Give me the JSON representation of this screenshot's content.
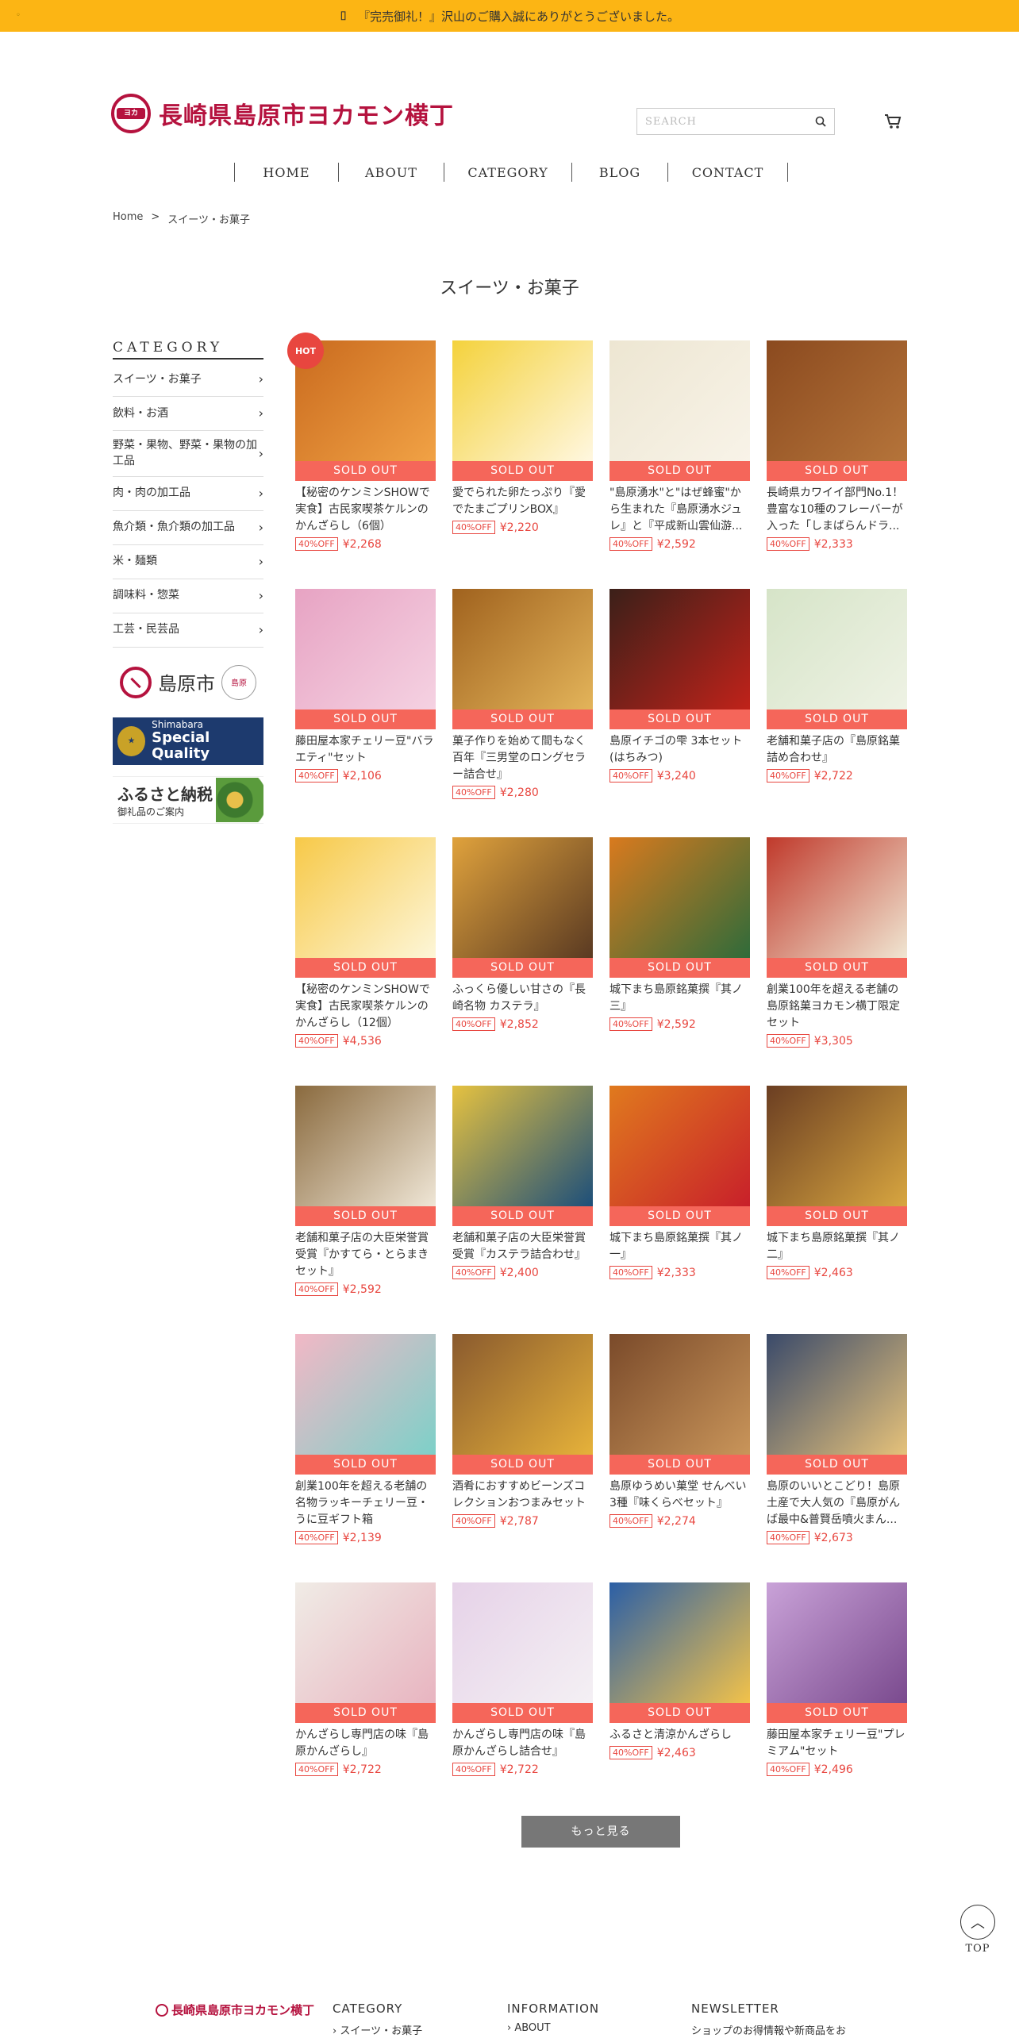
{
  "announcement": {
    "mark": "⌷",
    "text": "『完売御礼！』沢山のご購入誠にありがとうございました。"
  },
  "header": {
    "logo_text": "長崎県島原市ヨカモン横丁",
    "search_placeholder": "SEARCH",
    "nav": [
      "HOME",
      "ABOUT",
      "CATEGORY",
      "BLOG",
      "CONTACT"
    ]
  },
  "breadcrumb": {
    "home": "Home",
    "sep": ">",
    "current": "スイーツ・お菓子"
  },
  "page_title": "スイーツ・お菓子",
  "sidebar": {
    "heading": "CATEGORY",
    "categories": [
      "スイーツ・お菓子",
      "飲料・お酒",
      "野菜・果物、野菜・果物の加工品",
      "肉・肉の加工品",
      "魚介類・魚介類の加工品",
      "米・麺類",
      "調味料・惣菜",
      "工芸・民芸品"
    ],
    "banner_city": "島原市",
    "banner_quality_top": "Shimabara",
    "banner_quality_main": "Special Quality",
    "banner_furusato": "ふるさと納税",
    "banner_furusato_sub": "御礼品のご案内"
  },
  "products": [
    {
      "name": "【秘密のケンミンSHOWで実食】古民家喫茶ケルンのかんざらし（6個）",
      "price": "¥2,268",
      "hot": true,
      "colors": [
        "#c96a1e",
        "#f1a245"
      ]
    },
    {
      "name": "愛でられた卵たっぷり『愛でたまごプリンBOX』",
      "price": "¥2,220",
      "colors": [
        "#f4d23c",
        "#fff7e0"
      ]
    },
    {
      "name": "\"島原湧水\"と\"はぜ蜂蜜\"から生まれた『島原湧水ジュレ』と『平成新山雲仙游...",
      "price": "¥2,592",
      "colors": [
        "#ede6d2",
        "#f8f3e8"
      ]
    },
    {
      "name": "長崎県カワイイ部門No.1！豊富な10種のフレーバーが入った「しまばらんドラ...",
      "price": "¥2,333",
      "colors": [
        "#8b4a1f",
        "#b5743a"
      ]
    },
    {
      "name": "藤田屋本家チェリー豆\"バラエティ\"セット",
      "price": "¥2,106",
      "colors": [
        "#e7a3c3",
        "#f5d2e2"
      ]
    },
    {
      "name": "菓子作りを始めて間もなく百年『三男堂のロングセラー詰合せ』",
      "price": "¥2,280",
      "colors": [
        "#a0621e",
        "#e3b45a"
      ]
    },
    {
      "name": "島原イチゴの雫 3本セット(はちみつ)",
      "price": "¥3,240",
      "colors": [
        "#3b2019",
        "#c0221a"
      ]
    },
    {
      "name": "老舗和菓子店の『島原銘菓詰め合わせ』",
      "price": "¥2,722",
      "colors": [
        "#d6e4c8",
        "#eef2e4"
      ]
    },
    {
      "name": "【秘密のケンミンSHOWで実食】古民家喫茶ケルンのかんざらし（12個）",
      "price": "¥4,536",
      "colors": [
        "#f7c948",
        "#fdf6d8"
      ]
    },
    {
      "name": "ふっくら優しい甘さの『長崎名物 カステラ』",
      "price": "¥2,852",
      "colors": [
        "#e0a23c",
        "#5a3a22"
      ]
    },
    {
      "name": "城下まち島原銘菓撰『其ノ三』",
      "price": "¥2,592",
      "colors": [
        "#d97a1e",
        "#2f6b3a"
      ]
    },
    {
      "name": "創業100年を超える老舗の島原銘菓ヨカモン横丁限定セット",
      "price": "¥3,305",
      "colors": [
        "#c0392b",
        "#f0e6d2"
      ]
    },
    {
      "name": "老舗和菓子店の大臣栄誉賞受賞『かすてら・とらまきセット』",
      "price": "¥2,592",
      "colors": [
        "#8a6a3e",
        "#efe6d6"
      ]
    },
    {
      "name": "老舗和菓子店の大臣栄誉賞受賞『カステラ詰合わせ』",
      "price": "¥2,400",
      "colors": [
        "#e6c240",
        "#1d4f7a"
      ]
    },
    {
      "name": "城下まち島原銘菓撰『其ノ一』",
      "price": "¥2,333",
      "colors": [
        "#e07a1e",
        "#c8202a"
      ]
    },
    {
      "name": "城下まち島原銘菓撰『其ノ二』",
      "price": "¥2,463",
      "colors": [
        "#6b3e22",
        "#d8a640"
      ]
    },
    {
      "name": "創業100年を超える老舗の名物ラッキーチェリー豆・うに豆ギフト箱",
      "price": "¥2,139",
      "colors": [
        "#f2b8c6",
        "#7dd0c8"
      ]
    },
    {
      "name": "酒肴におすすめビーンズコレクションおつまみセット",
      "price": "¥2,787",
      "colors": [
        "#8a5a2e",
        "#e6b23a"
      ]
    },
    {
      "name": "島原ゆうめい菓堂 せんべい3種『味くらべセット』",
      "price": "¥2,274",
      "colors": [
        "#7a4a2a",
        "#c9955a"
      ]
    },
    {
      "name": "島原のいいとこどり！島原土産で大人気の『島原がんば最中&普賢岳噴火まん...",
      "price": "¥2,673",
      "colors": [
        "#3a4a6a",
        "#e6c27a"
      ]
    },
    {
      "name": "かんざらし専門店の味『島原かんざらし』",
      "price": "¥2,722",
      "colors": [
        "#f0ece6",
        "#e8b4c0"
      ]
    },
    {
      "name": "かんざらし専門店の味『島原かんざらし詰合せ』",
      "price": "¥2,722",
      "colors": [
        "#e6d2e8",
        "#f4f0f4"
      ]
    },
    {
      "name": "ふるさと清涼かんざらし",
      "price": "¥2,463",
      "colors": [
        "#2b5fa6",
        "#f2c24a"
      ]
    },
    {
      "name": "藤田屋本家チェリー豆\"プレミアム\"セット",
      "price": "¥2,496",
      "colors": [
        "#c9a2d8",
        "#7a4a8e"
      ]
    }
  ],
  "labels": {
    "sold_out": "SOLD OUT",
    "discount": "40%OFF",
    "hot": "HOT"
  },
  "more_button": "もっと見る",
  "to_top": "TOP",
  "footer": {
    "logo_text": "長崎県島原市ヨカモン横丁",
    "col1_heading": "CATEGORY",
    "col1_link": "› スイーツ・お菓子",
    "col2_heading": "INFORMATION",
    "col2_link": "› ABOUT",
    "col3_heading": "NEWSLETTER",
    "col3_text": "ショップのお得情報や新商品をお"
  },
  "colors": {
    "accent": "#fcb514",
    "brand": "#b5123e",
    "sale": "#e8463f",
    "soldout": "#f5665a"
  }
}
